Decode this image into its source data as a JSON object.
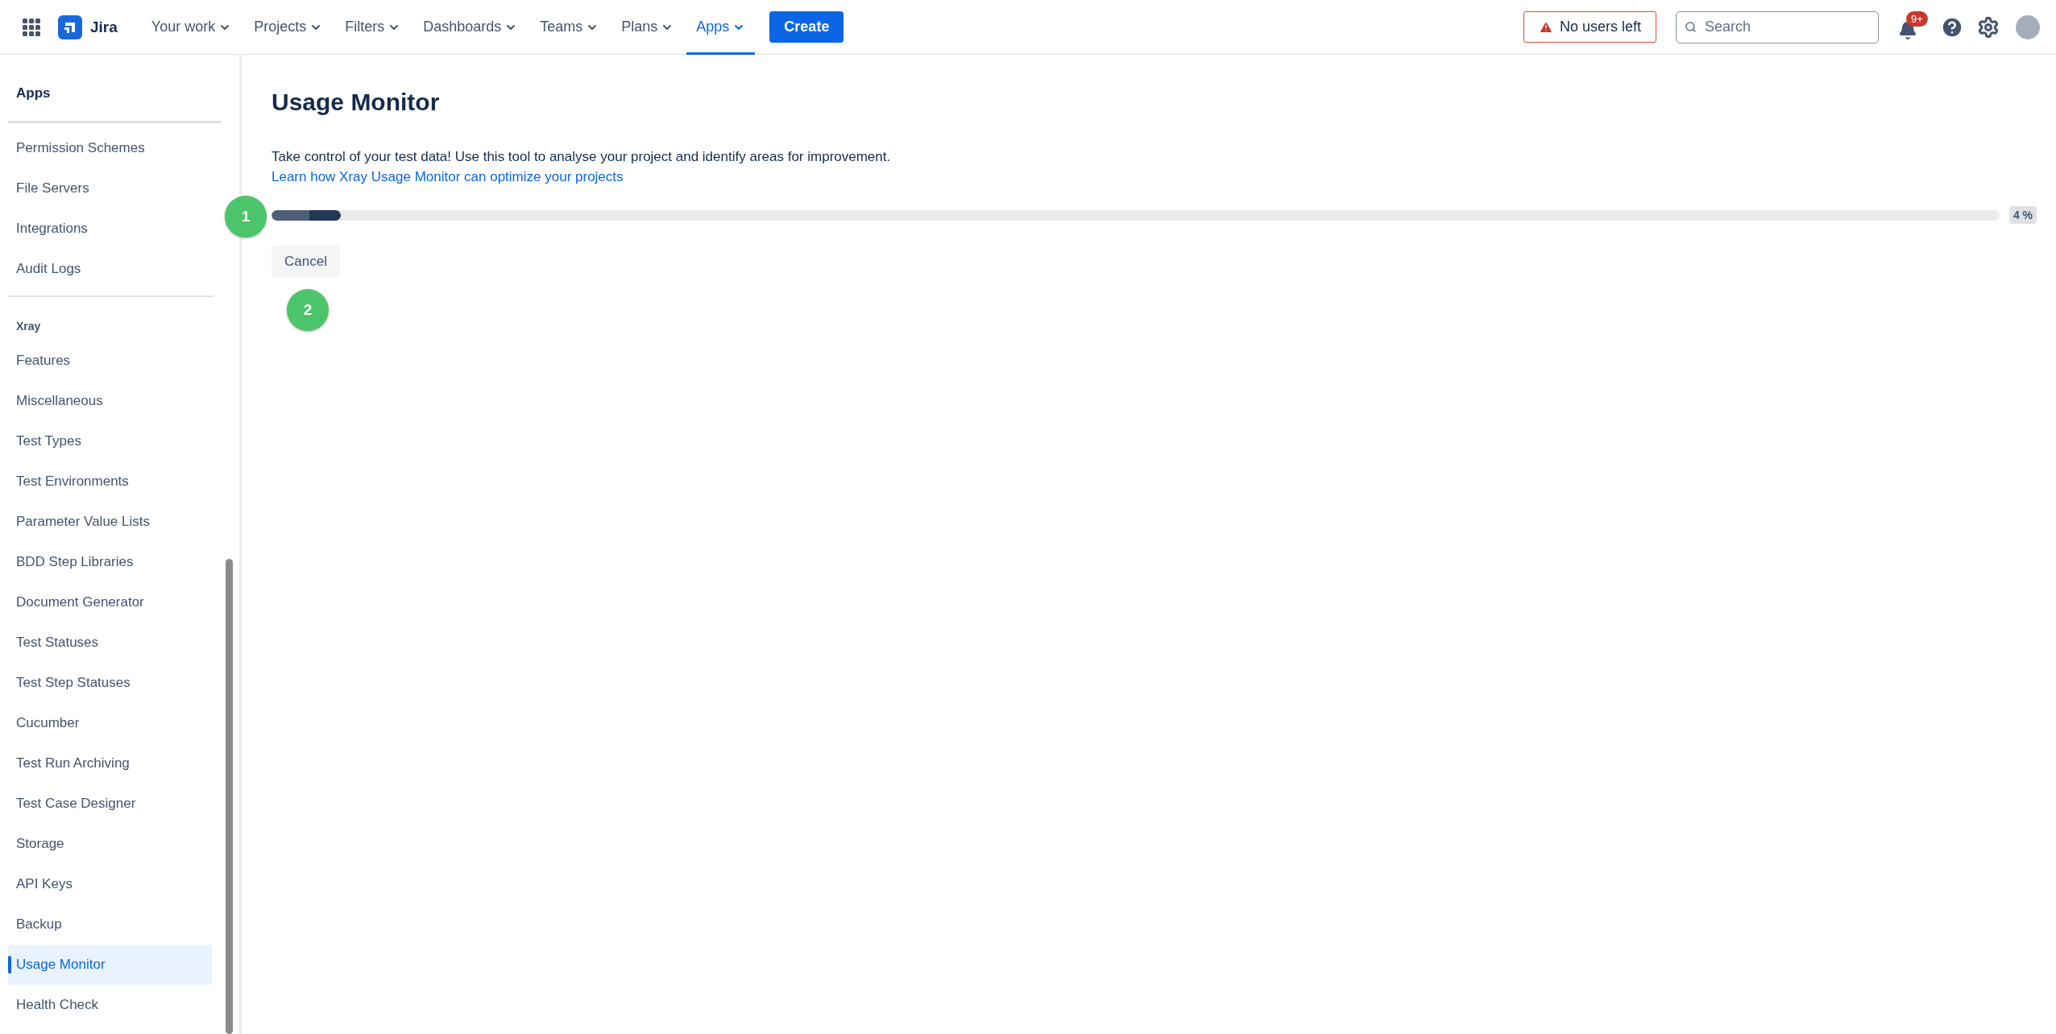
{
  "topbar": {
    "product": "Jira",
    "nav": [
      {
        "label": "Your work",
        "selected": false
      },
      {
        "label": "Projects",
        "selected": false
      },
      {
        "label": "Filters",
        "selected": false
      },
      {
        "label": "Dashboards",
        "selected": false
      },
      {
        "label": "Teams",
        "selected": false
      },
      {
        "label": "Plans",
        "selected": false
      },
      {
        "label": "Apps",
        "selected": true
      }
    ],
    "create": "Create",
    "alert": "No users left",
    "search": {
      "placeholder": "Search"
    },
    "notification_badge": "9+"
  },
  "sidebar": {
    "title": "Apps",
    "sections": [
      {
        "items": [
          {
            "label": "Permission Schemes",
            "selected": false
          },
          {
            "label": "File Servers",
            "selected": false
          },
          {
            "label": "Integrations",
            "selected": false
          },
          {
            "label": "Audit Logs",
            "selected": false
          }
        ]
      },
      {
        "heading": "Xray",
        "items": [
          {
            "label": "Features",
            "selected": false
          },
          {
            "label": "Miscellaneous",
            "selected": false
          },
          {
            "label": "Test Types",
            "selected": false
          },
          {
            "label": "Test Environments",
            "selected": false
          },
          {
            "label": "Parameter Value Lists",
            "selected": false
          },
          {
            "label": "BDD Step Libraries",
            "selected": false
          },
          {
            "label": "Document Generator",
            "selected": false
          },
          {
            "label": "Test Statuses",
            "selected": false
          },
          {
            "label": "Test Step Statuses",
            "selected": false
          },
          {
            "label": "Cucumber",
            "selected": false
          },
          {
            "label": "Test Run Archiving",
            "selected": false
          },
          {
            "label": "Test Case Designer",
            "selected": false
          },
          {
            "label": "Storage",
            "selected": false
          },
          {
            "label": "API Keys",
            "selected": false
          },
          {
            "label": "Backup",
            "selected": false
          },
          {
            "label": "Usage Monitor",
            "selected": true
          },
          {
            "label": "Health Check",
            "selected": false
          }
        ]
      }
    ]
  },
  "main": {
    "title": "Usage Monitor",
    "description": "Take control of your test data! Use this tool to analyse your project and identify areas for improvement.",
    "link": "Learn how Xray Usage Monitor can optimize your projects",
    "progress": {
      "level": 0.04,
      "reading": "4 %"
    },
    "cancel": "Cancel",
    "step_markers": [
      "1",
      "2"
    ]
  }
}
